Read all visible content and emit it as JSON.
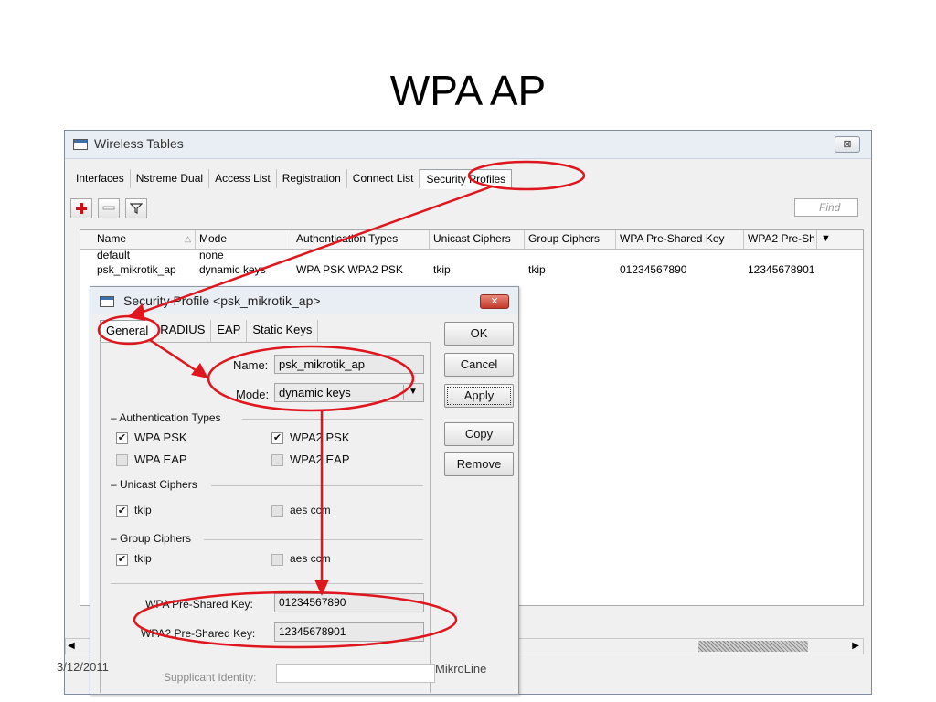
{
  "slide": {
    "title": "WPA AP",
    "date": "3/12/2011",
    "footer": "MikroLine"
  },
  "window": {
    "title": "Wireless Tables",
    "close_label": "⊠",
    "tabs": [
      "Interfaces",
      "Nstreme Dual",
      "Access List",
      "Registration",
      "Connect List",
      "Security Profiles"
    ],
    "active_tab": "Security Profiles",
    "find_placeholder": "Find",
    "columns": [
      "Name",
      "Mode",
      "Authentication Types",
      "Unicast Ciphers",
      "Group Ciphers",
      "WPA Pre-Shared Key",
      "WPA2 Pre-Sh"
    ],
    "rows": [
      {
        "name": "default",
        "mode": "none",
        "auth": "",
        "unicast": "",
        "group": "",
        "wpa_key": "",
        "wpa2_key": ""
      },
      {
        "name": "psk_mikrotik_ap",
        "mode": "dynamic keys",
        "auth": "WPA PSK WPA2 PSK",
        "unicast": "tkip",
        "group": "tkip",
        "wpa_key": "01234567890",
        "wpa2_key": "12345678901"
      }
    ]
  },
  "dialog": {
    "title": "Security Profile <psk_mikrotik_ap>",
    "close_label": "✕",
    "tabs": [
      "General",
      "RADIUS",
      "EAP",
      "Static Keys"
    ],
    "active_tab": "General",
    "name_label": "Name:",
    "name_value": "psk_mikrotik_ap",
    "mode_label": "Mode:",
    "mode_value": "dynamic keys",
    "auth_group": "Authentication Types",
    "auth": [
      {
        "label": "WPA PSK",
        "checked": true
      },
      {
        "label": "WPA2 PSK",
        "checked": true
      },
      {
        "label": "WPA EAP",
        "checked": false
      },
      {
        "label": "WPA2 EAP",
        "checked": false
      }
    ],
    "unicast_group": "Unicast Ciphers",
    "unicast": [
      {
        "label": "tkip",
        "checked": true
      },
      {
        "label": "aes ccm",
        "checked": false
      }
    ],
    "group_group": "Group Ciphers",
    "group": [
      {
        "label": "tkip",
        "checked": true
      },
      {
        "label": "aes ccm",
        "checked": false
      }
    ],
    "wpa_key_label": "WPA Pre-Shared Key:",
    "wpa_key_value": "01234567890",
    "wpa2_key_label": "WPA2 Pre-Shared Key:",
    "wpa2_key_value": "12345678901",
    "supplicant_label": "Supplicant Identity:",
    "supplicant_value": "",
    "buttons": {
      "ok": "OK",
      "cancel": "Cancel",
      "apply": "Apply",
      "copy": "Copy",
      "remove": "Remove"
    }
  },
  "colors": {
    "annotation": "#e0161e"
  }
}
